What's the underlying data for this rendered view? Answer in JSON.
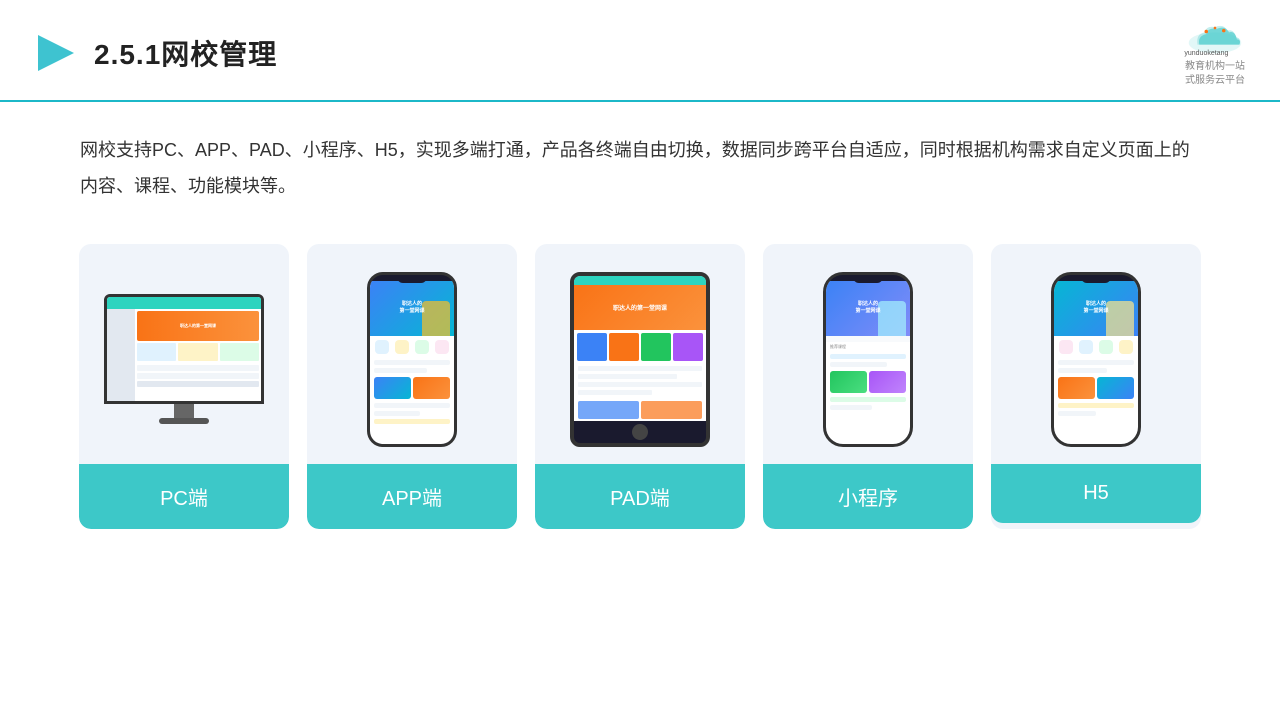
{
  "header": {
    "title": "2.5.1网校管理",
    "logo_url": "yunduoketang.com",
    "logo_tagline": "教育机构一站\n式服务云平台"
  },
  "description": "网校支持PC、APP、PAD、小程序、H5，实现多端打通，产品各终端自由切换，数据同步跨平台自适应，同时根据机构需求自定义页面上的内容、课程、功能模块等。",
  "cards": [
    {
      "id": "pc",
      "label": "PC端"
    },
    {
      "id": "app",
      "label": "APP端"
    },
    {
      "id": "pad",
      "label": "PAD端"
    },
    {
      "id": "miniapp",
      "label": "小程序"
    },
    {
      "id": "h5",
      "label": "H5"
    }
  ],
  "colors": {
    "accent": "#3dc8c8",
    "header_line": "#1cb8c8",
    "card_bg": "#f0f4fa"
  }
}
